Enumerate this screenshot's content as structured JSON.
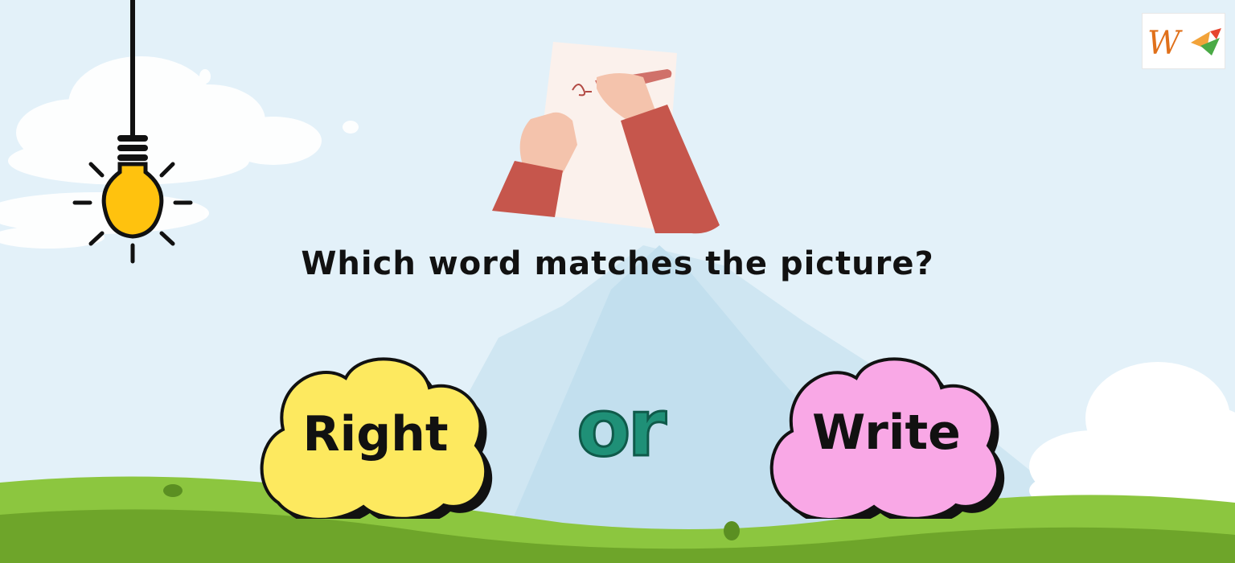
{
  "question": {
    "text": "Which word matches the picture?"
  },
  "choices": [
    {
      "label": "Right",
      "color": "#fde95f"
    },
    {
      "label": "Write",
      "color": "#f9a8e6"
    }
  ],
  "connector": {
    "text": "or",
    "color": "#1f9077"
  },
  "colors": {
    "sky": "#e3f1f9",
    "mountain": "#c9e4f1",
    "grass": "#7fb82a",
    "bulb": "#ffc20e",
    "sleeve": "#c6564c"
  },
  "icons": [
    "lightbulb-icon",
    "writing-hand-illustration",
    "brand-logo"
  ]
}
